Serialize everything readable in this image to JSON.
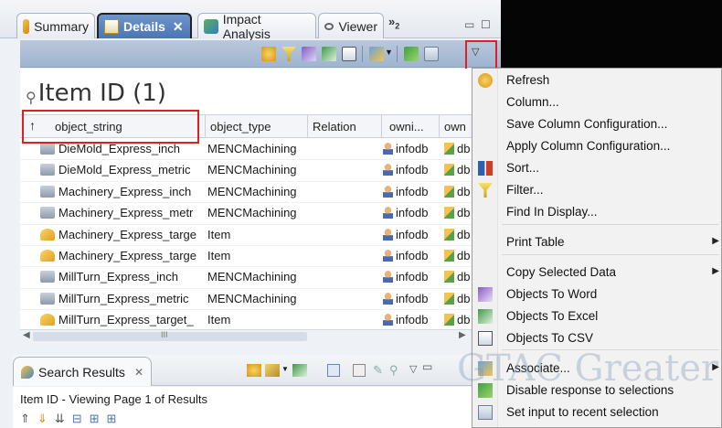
{
  "tabs": [
    {
      "label": "Summary",
      "active": false
    },
    {
      "label": "Details",
      "active": true
    },
    {
      "label": "Impact Analysis",
      "active": false
    },
    {
      "label": "Viewer",
      "active": false
    }
  ],
  "overflow": {
    "chevrons": "»",
    "count": "2"
  },
  "details": {
    "title": "Item ID (1)",
    "columns": [
      "object_string",
      "object_type",
      "Relation",
      "owni...",
      "own"
    ],
    "rows": [
      {
        "object_string": "DieMold_Express_inch",
        "object_type": "MENCMachining",
        "owning_user": "infodb",
        "owning_group": "db",
        "icon": "machining-icon"
      },
      {
        "object_string": "DieMold_Express_metric",
        "object_type": "MENCMachining",
        "owning_user": "infodb",
        "owning_group": "db",
        "icon": "machining-icon"
      },
      {
        "object_string": "Machinery_Express_inch",
        "object_type": "MENCMachining",
        "owning_user": "infodb",
        "owning_group": "db",
        "icon": "machining-icon"
      },
      {
        "object_string": "Machinery_Express_metr",
        "object_type": "MENCMachining",
        "owning_user": "infodb",
        "owning_group": "db",
        "icon": "machining-icon"
      },
      {
        "object_string": "Machinery_Express_targe",
        "object_type": "Item",
        "owning_user": "infodb",
        "owning_group": "db",
        "icon": "item-icon"
      },
      {
        "object_string": "Machinery_Express_targe",
        "object_type": "Item",
        "owning_user": "infodb",
        "owning_group": "db",
        "icon": "item-icon"
      },
      {
        "object_string": "MillTurn_Express_inch",
        "object_type": "MENCMachining",
        "owning_user": "infodb",
        "owning_group": "db",
        "icon": "machining-icon"
      },
      {
        "object_string": "MillTurn_Express_metric",
        "object_type": "MENCMachining",
        "owning_user": "infodb",
        "owning_group": "db",
        "icon": "machining-icon"
      },
      {
        "object_string": "MillTurn_Express_target_",
        "object_type": "Item",
        "owning_user": "infodb",
        "owning_group": "db",
        "icon": "item-icon"
      }
    ],
    "scroll_thumb_label": "III"
  },
  "search_results": {
    "tab_label": "Search Results",
    "tab_close": "✕",
    "paging_text": "Item ID - Viewing Page 1 of Results"
  },
  "menu": {
    "items": [
      {
        "label": "Refresh",
        "icon": "refresh-icon",
        "submenu": false
      },
      {
        "label": "Column...",
        "icon": "",
        "submenu": false
      },
      {
        "label": "Save Column Configuration...",
        "icon": "",
        "submenu": false
      },
      {
        "label": "Apply Column Configuration...",
        "icon": "",
        "submenu": false
      },
      {
        "label": "Sort...",
        "icon": "sort-icon",
        "submenu": false
      },
      {
        "label": "Filter...",
        "icon": "filter-icon",
        "submenu": false
      },
      {
        "label": "Find In Display...",
        "icon": "",
        "submenu": false
      },
      {
        "label": "Print Table",
        "icon": "",
        "submenu": true
      },
      {
        "label": "Copy Selected Data",
        "icon": "",
        "submenu": true
      },
      {
        "label": "Objects To Word",
        "icon": "word-icon",
        "submenu": false
      },
      {
        "label": "Objects To Excel",
        "icon": "excel-icon",
        "submenu": false
      },
      {
        "label": "Objects To CSV",
        "icon": "csv-icon",
        "submenu": false
      },
      {
        "label": "Associate...",
        "icon": "associate-icon",
        "submenu": true
      },
      {
        "label": "Disable response to selections",
        "icon": "disable-icon",
        "submenu": false
      },
      {
        "label": "Set input to recent selection",
        "icon": "set-input-icon",
        "submenu": false
      }
    ]
  },
  "watermark": "GTAC Greater",
  "colors": {
    "highlight_red": "#e02020",
    "toolbar_blue": "#a9bdd6",
    "active_tab": "#4a75b5"
  }
}
